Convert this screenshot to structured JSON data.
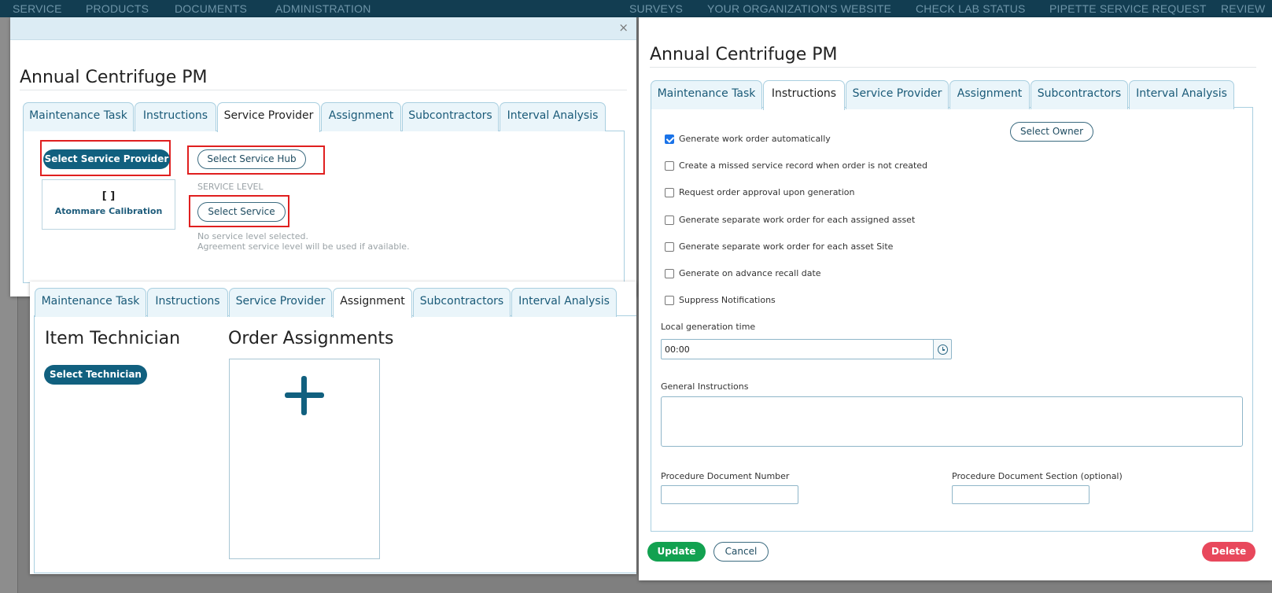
{
  "topnav": {
    "items": [
      "SERVICE",
      "PRODUCTS",
      "DOCUMENTS",
      "ADMINISTRATION",
      "SURVEYS",
      "YOUR ORGANIZATION'S WEBSITE",
      "CHECK LAB STATUS",
      "PIPETTE SERVICE REQUEST",
      "REVIEW"
    ]
  },
  "dialog1": {
    "close_glyph": "×",
    "title": "Annual Centrifuge PM",
    "tabs": [
      "Maintenance Task",
      "Instructions",
      "Service Provider",
      "Assignment",
      "Subcontractors",
      "Interval Analysis"
    ],
    "active_tab": "Service Provider",
    "select_provider_label": "Select Service Provider",
    "select_hub_label": "Select Service Hub",
    "provider_card": {
      "brackets": "[ ]",
      "name": "Atommare Calibration"
    },
    "service_level_label": "SERVICE LEVEL",
    "select_service_label": "Select Service",
    "no_level_text": "No service level selected.",
    "agreement_text": "Agreement service level will be used if available."
  },
  "dialog2": {
    "tabs": [
      "Maintenance Task",
      "Instructions",
      "Service Provider",
      "Assignment",
      "Subcontractors",
      "Interval Analysis"
    ],
    "active_tab": "Assignment",
    "item_technician_heading": "Item Technician",
    "select_technician_label": "Select Technician",
    "order_assignments_heading": "Order Assignments",
    "add_icon": "plus-icon"
  },
  "dialog3": {
    "title": "Annual Centrifuge PM",
    "tabs": [
      "Maintenance Task",
      "Instructions",
      "Service Provider",
      "Assignment",
      "Subcontractors",
      "Interval Analysis"
    ],
    "active_tab": "Instructions",
    "select_owner_label": "Select Owner",
    "checkboxes": [
      {
        "label": "Generate work order automatically",
        "checked": true
      },
      {
        "label": "Create a missed service record when order is not created",
        "checked": false
      },
      {
        "label": "Request order approval upon generation",
        "checked": false
      },
      {
        "label": "Generate separate work order for each assigned asset",
        "checked": false
      },
      {
        "label": "Generate separate work order for each asset Site",
        "checked": false
      },
      {
        "label": "Generate on advance recall date",
        "checked": false
      },
      {
        "label": "Suppress Notifications",
        "checked": false
      }
    ],
    "local_time_label": "Local generation time",
    "local_time_value": "00:00",
    "general_instructions_label": "General Instructions",
    "general_instructions_value": "",
    "doc_number_label": "Procedure Document Number",
    "doc_number_value": "",
    "doc_section_label": "Procedure Document Section (optional)",
    "doc_section_value": "",
    "update_label": "Update",
    "cancel_label": "Cancel",
    "delete_label": "Delete"
  },
  "colors": {
    "nav_bg": "#123d51",
    "primary": "#11607f",
    "tab_border": "#a9cfe0",
    "update_green": "#12a150",
    "delete_red": "#e8485c",
    "highlight_red": "#e01f1f"
  }
}
